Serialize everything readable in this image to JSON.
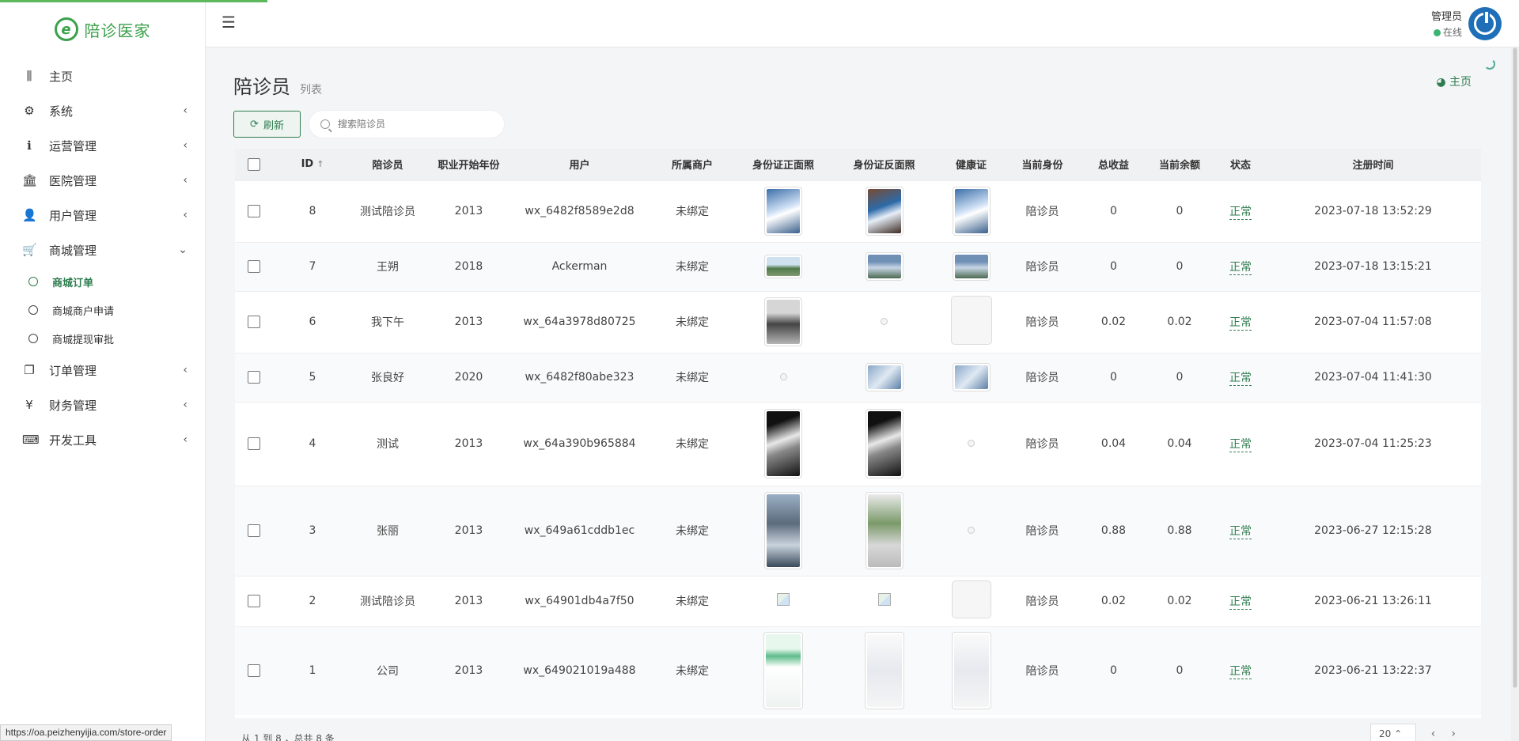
{
  "brand": {
    "name": "陪诊医家",
    "logo_letter": "e"
  },
  "sidebar": {
    "items": [
      {
        "label": "主页",
        "icon": "bar-chart-icon",
        "glyph": "⫼",
        "chev": ""
      },
      {
        "label": "系统",
        "icon": "gear-icon",
        "glyph": "⚙",
        "chev": "‹"
      },
      {
        "label": "运营管理",
        "icon": "info-icon",
        "glyph": "ℹ",
        "chev": "‹"
      },
      {
        "label": "医院管理",
        "icon": "bank-icon",
        "glyph": "🏛",
        "chev": "‹"
      },
      {
        "label": "用户管理",
        "icon": "user-card-icon",
        "glyph": "👤",
        "chev": "‹"
      },
      {
        "label": "商城管理",
        "icon": "cart-icon",
        "glyph": "🛒",
        "chev": "⌄"
      }
    ],
    "sub_items": [
      {
        "label": "商城订单",
        "active": true
      },
      {
        "label": "商城商户申请",
        "active": false
      },
      {
        "label": "商城提现审批",
        "active": false
      }
    ],
    "items_after": [
      {
        "label": "订单管理",
        "icon": "copy-icon",
        "glyph": "❐",
        "chev": "‹"
      },
      {
        "label": "财务管理",
        "icon": "yen-icon",
        "glyph": "¥",
        "chev": "‹"
      },
      {
        "label": "开发工具",
        "icon": "keyboard-icon",
        "glyph": "⌨",
        "chev": "‹"
      }
    ]
  },
  "header": {
    "user_name": "管理员",
    "user_status": "在线"
  },
  "page": {
    "title": "陪诊员",
    "subtitle": "列表",
    "home_link": "主页"
  },
  "toolbar": {
    "refresh_label": "刷新",
    "search_placeholder": "搜索陪诊员"
  },
  "table": {
    "columns": [
      "ID",
      "陪诊员",
      "职业开始年份",
      "用户",
      "所属商户",
      "身份证正面照",
      "身份证反面照",
      "健康证",
      "当前身份",
      "总收益",
      "当前余额",
      "状态",
      "注册时间"
    ],
    "rows": [
      {
        "id": "8",
        "name": "测试陪诊员",
        "year": "2013",
        "user": "wx_6482f8589e2d8",
        "merchant": "未绑定",
        "front": "tall-blue",
        "back": "tall-dark",
        "health": "tall-blue",
        "role": "陪诊员",
        "income": "0",
        "balance": "0",
        "status": "正常",
        "time": "2023-07-18 13:52:29",
        "h": 78
      },
      {
        "id": "7",
        "name": "王朔",
        "year": "2018",
        "user": "Ackerman",
        "merchant": "未绑定",
        "front": "wide-landscape",
        "back": "wide-sky",
        "health": "wide-sky",
        "role": "陪诊员",
        "income": "0",
        "balance": "0",
        "status": "正常",
        "time": "2023-07-18 13:15:21",
        "h": 62
      },
      {
        "id": "6",
        "name": "我下午",
        "year": "2013",
        "user": "wx_64a3978d80725",
        "merchant": "未绑定",
        "front": "laptop",
        "back": "empty",
        "health": "blank",
        "role": "陪诊员",
        "income": "0.02",
        "balance": "0.02",
        "status": "正常",
        "time": "2023-07-04 11:57:08",
        "h": 78
      },
      {
        "id": "5",
        "name": "张良好",
        "year": "2020",
        "user": "wx_6482f80abe323",
        "merchant": "未绑定",
        "front": "empty",
        "back": "wide-building",
        "health": "wide-building",
        "role": "陪诊员",
        "income": "0",
        "balance": "0",
        "status": "正常",
        "time": "2023-07-04 11:41:30",
        "h": 62
      },
      {
        "id": "4",
        "name": "测试",
        "year": "2013",
        "user": "wx_64a390b965884",
        "merchant": "未绑定",
        "front": "cable",
        "back": "cable",
        "health": "empty",
        "role": "陪诊员",
        "income": "0.04",
        "balance": "0.04",
        "status": "正常",
        "time": "2023-07-04 11:25:23",
        "h": 106
      },
      {
        "id": "3",
        "name": "张丽",
        "year": "2013",
        "user": "wx_649a61cddb1ec",
        "merchant": "未绑定",
        "front": "street",
        "back": "store",
        "health": "empty",
        "role": "陪诊员",
        "income": "0.88",
        "balance": "0.88",
        "status": "正常",
        "time": "2023-06-27 12:15:28",
        "h": 114
      },
      {
        "id": "2",
        "name": "测试陪诊员",
        "year": "2013",
        "user": "wx_64901db4a7f50",
        "merchant": "未绑定",
        "front": "broken",
        "back": "broken",
        "health": "blank-small",
        "role": "陪诊员",
        "income": "0.02",
        "balance": "0.02",
        "status": "正常",
        "time": "2023-06-21 13:26:11",
        "h": 64
      },
      {
        "id": "1",
        "name": "公司",
        "year": "2013",
        "user": "wx_649021019a488",
        "merchant": "未绑定",
        "front": "phone-green",
        "back": "phone-white",
        "health": "phone-white",
        "role": "陪诊员",
        "income": "0",
        "balance": "0",
        "status": "正常",
        "time": "2023-06-21 13:22:37",
        "h": 112
      }
    ]
  },
  "footer": {
    "info": "从 1 到 8 ，总共 8 条",
    "page_size": "20"
  },
  "url_tip": "https://oa.peizhenyijia.com/store-order",
  "colors": {
    "accent": "#2e7d4f",
    "brand": "#3aa04a",
    "avatar": "#1e6fb8"
  }
}
